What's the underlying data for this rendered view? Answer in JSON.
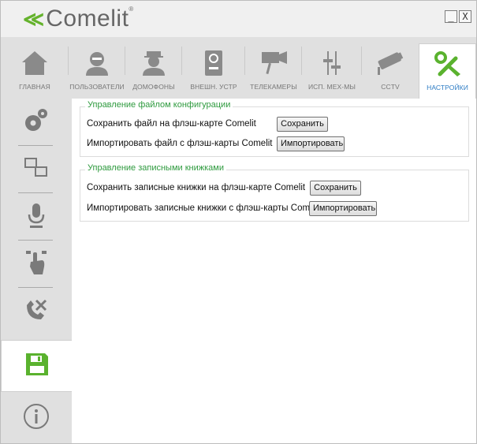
{
  "app": {
    "logo_text": "Comelit",
    "logo_mark": "≪",
    "registered": "®",
    "minimize_glyph": "_",
    "close_glyph": "X"
  },
  "tabs": [
    {
      "label": "ГЛАВНАЯ",
      "icon": "home-icon"
    },
    {
      "label": "ПОЛЬЗОВАТЕЛИ",
      "icon": "user-icon"
    },
    {
      "label": "ДОМОФОНЫ",
      "icon": "doorman-icon"
    },
    {
      "label": "ВНЕШН. УСТР",
      "icon": "intercom-panel-icon"
    },
    {
      "label": "ТЕЛЕКАМЕРЫ",
      "icon": "camera-icon"
    },
    {
      "label": "ИСП. МЕХ-МЫ",
      "icon": "actuator-sliders-icon"
    },
    {
      "label": "CCTV",
      "icon": "cctv-icon"
    },
    {
      "label": "НАСТРОЙКИ",
      "icon": "tools-icon",
      "active": true
    }
  ],
  "sidebar": [
    {
      "icon": "gears-icon"
    },
    {
      "icon": "computers-icon"
    },
    {
      "icon": "microphone-icon"
    },
    {
      "icon": "touch-icon"
    },
    {
      "icon": "phone-tools-icon"
    },
    {
      "icon": "save-icon",
      "active": true
    },
    {
      "icon": "info-icon"
    }
  ],
  "config_group": {
    "title": "Управление файлом конфигурации",
    "rows": [
      {
        "label": "Сохранить файл на флэш-карте Comelit",
        "button": "Сохранить"
      },
      {
        "label": "Импортировать файл с флэш-карты Comelit",
        "button": "Импортировать"
      }
    ]
  },
  "addressbook_group": {
    "title": "Управление записными книжками",
    "rows": [
      {
        "label": "Сохранить записные книжки на флэш-карте Comelit",
        "button": "Сохранить"
      },
      {
        "label": "Импортировать записные книжки с флэш-карты Comelit",
        "button": "Импортировать"
      }
    ]
  },
  "colors": {
    "accent_green": "#5ab22e",
    "active_label_blue": "#2d7cc4",
    "group_title_green": "#2e9a3e",
    "icon_gray": "#8a8a8a"
  }
}
